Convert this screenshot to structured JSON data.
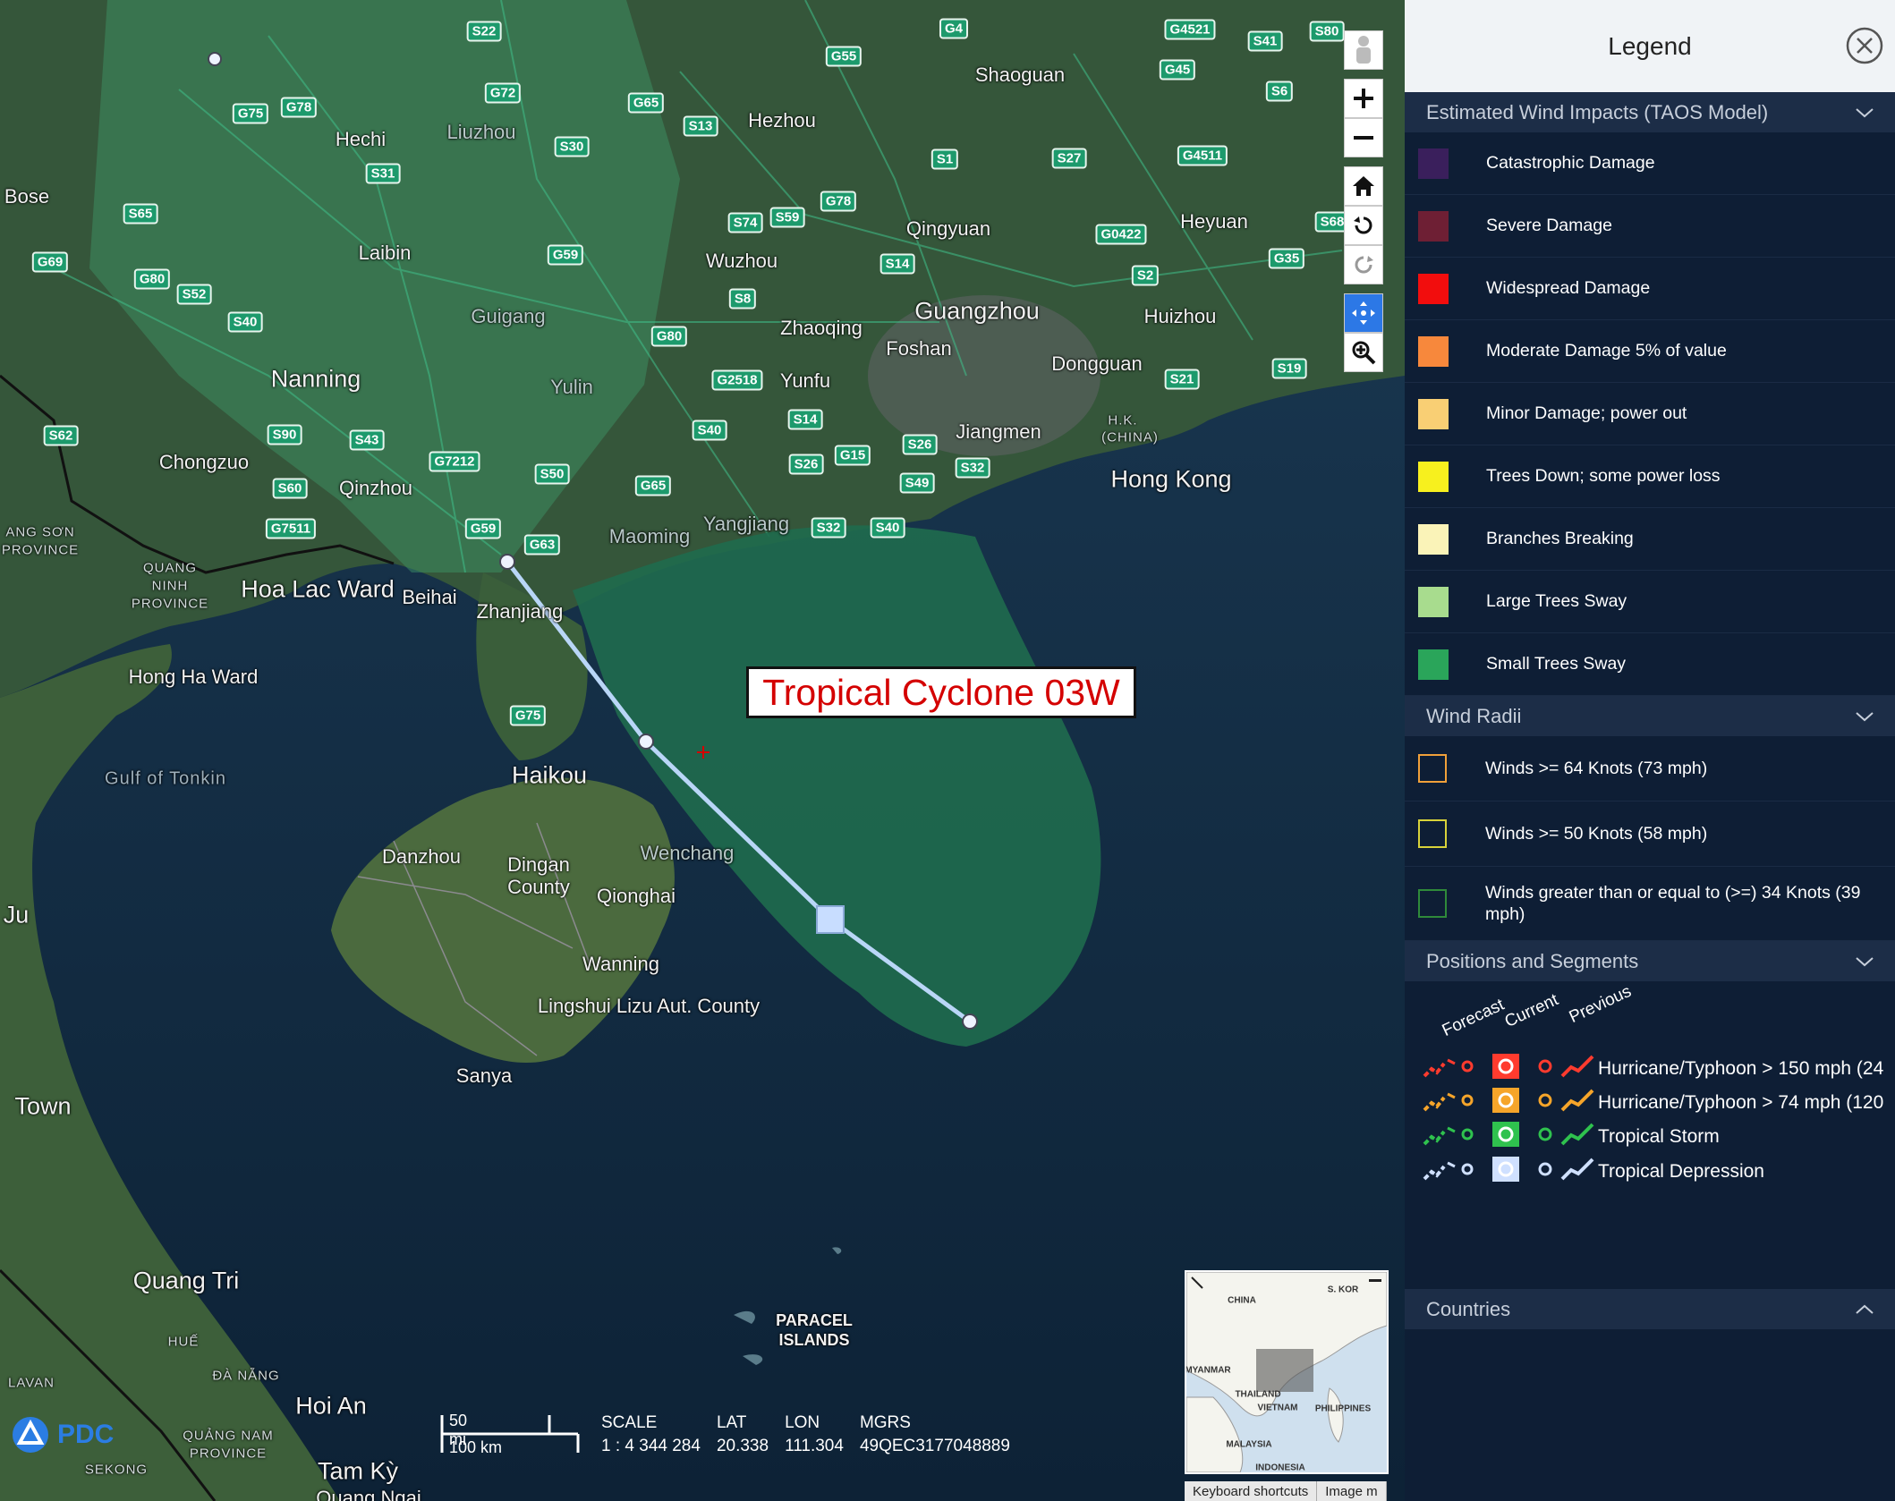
{
  "map": {
    "cyclone_label": "Tropical Cyclone 03W",
    "places": [
      {
        "name": "Shaoguan",
        "cls": "mid"
      },
      {
        "name": "Hezhou",
        "cls": "mid"
      },
      {
        "name": "Hechi",
        "cls": "mid"
      },
      {
        "name": "Liuzhou",
        "cls": "mid faint"
      },
      {
        "name": "Bose",
        "cls": "mid"
      },
      {
        "name": "Laibin",
        "cls": "mid"
      },
      {
        "name": "Qingyuan",
        "cls": "mid"
      },
      {
        "name": "Heyuan",
        "cls": "mid"
      },
      {
        "name": "Wuzhou",
        "cls": "mid"
      },
      {
        "name": "Guigang",
        "cls": "mid faint"
      },
      {
        "name": "Guangzhou",
        "cls": "major"
      },
      {
        "name": "Huizhou",
        "cls": "mid"
      },
      {
        "name": "Zhaoqing",
        "cls": "mid"
      },
      {
        "name": "Foshan",
        "cls": "mid"
      },
      {
        "name": "Nanning",
        "cls": "major"
      },
      {
        "name": "Yulin",
        "cls": "mid faint"
      },
      {
        "name": "Yunfu",
        "cls": "mid"
      },
      {
        "name": "Dongguan",
        "cls": "mid"
      },
      {
        "name": "Jiangmen",
        "cls": "mid"
      },
      {
        "name": "H.K.",
        "cls": "region"
      },
      {
        "name": "(CHINA)",
        "cls": "region"
      },
      {
        "name": "Hong Kong",
        "cls": "major"
      },
      {
        "name": "Chongzuo",
        "cls": "mid"
      },
      {
        "name": "Qinzhou",
        "cls": "mid"
      },
      {
        "name": "Maoming",
        "cls": "mid faint"
      },
      {
        "name": "Yangjiang",
        "cls": "mid faint"
      },
      {
        "name": "Hoa Lac Ward",
        "cls": "major"
      },
      {
        "name": "Beihai",
        "cls": "mid"
      },
      {
        "name": "Zhanjiang",
        "cls": "mid"
      },
      {
        "name": "Hong Ha Ward",
        "cls": "mid"
      },
      {
        "name": "Gulf of Tonkin",
        "cls": "sea"
      },
      {
        "name": "Haikou",
        "cls": "major"
      },
      {
        "name": "Danzhou",
        "cls": "mid"
      },
      {
        "name": "Dingan",
        "cls": "mid"
      },
      {
        "name": "County",
        "cls": "mid"
      },
      {
        "name": "Wenchang",
        "cls": "mid faint"
      },
      {
        "name": "Qionghai",
        "cls": "mid"
      },
      {
        "name": "Wanning",
        "cls": "mid"
      },
      {
        "name": "Lingshui Lizu Aut. County",
        "cls": "mid"
      },
      {
        "name": "Sanya",
        "cls": "mid"
      },
      {
        "name": "Town",
        "cls": "major"
      },
      {
        "name": "Quang Tri",
        "cls": "major"
      },
      {
        "name": "Hoi An",
        "cls": "major"
      },
      {
        "name": "Tam Kỳ",
        "cls": "major"
      },
      {
        "name": "HUẾ",
        "cls": "region"
      },
      {
        "name": "ĐÀ NẴNG",
        "cls": "region"
      },
      {
        "name": "QUẢNG NAM",
        "cls": "region"
      },
      {
        "name": "PROVINCE",
        "cls": "region"
      },
      {
        "name": "SEKONG",
        "cls": "region"
      },
      {
        "name": "LAVAN",
        "cls": "region"
      },
      {
        "name": "QUANG",
        "cls": "region"
      },
      {
        "name": "NINH",
        "cls": "region"
      },
      {
        "name": "PROVINCE",
        "cls": "region"
      },
      {
        "name": "ANG SƠN",
        "cls": "region"
      },
      {
        "name": "PROVINCE",
        "cls": "region"
      },
      {
        "name": "Ju",
        "cls": "major"
      },
      {
        "name": "Quang Ngai",
        "cls": "mid"
      }
    ],
    "islands_label": [
      "PARACEL",
      "ISLANDS"
    ],
    "shields": [
      "S22",
      "G72",
      "G75",
      "G78",
      "S31",
      "S30",
      "G65",
      "S13",
      "G55",
      "G4",
      "G4521",
      "S41",
      "S80",
      "G45",
      "S6",
      "S1",
      "S27",
      "G4511",
      "S65",
      "G69",
      "G80",
      "S52",
      "S40",
      "G59",
      "S74",
      "S59",
      "G78",
      "S14",
      "S8",
      "G0422",
      "S2",
      "G35",
      "S68",
      "G80",
      "G2518",
      "S14",
      "S40",
      "S26",
      "G15",
      "S26",
      "S32",
      "S49",
      "S62",
      "S90",
      "S43",
      "G7212",
      "S60",
      "G7511",
      "G59",
      "G63",
      "S50",
      "G65",
      "G75",
      "S19",
      "S21",
      "S32",
      "S40"
    ],
    "scale": {
      "bar_top": "50 mi",
      "bar_bottom": "100 km",
      "headers": [
        "SCALE",
        "LAT",
        "LON",
        "MGRS"
      ],
      "values": [
        "1 : 4 344 284",
        "20.338",
        "111.304",
        "49QEC3177048889"
      ]
    },
    "logo_text": "PDC",
    "minimap": {
      "labels": [
        "CHINA",
        "S. KOR",
        "MYANMAR",
        "THAILAND",
        "VIETNAM",
        "PHILIPPINES",
        "MALAYSIA",
        "INDONESIA"
      ]
    },
    "footer": [
      "Keyboard shortcuts",
      "Image m"
    ],
    "toolbar": [
      "street-view",
      "zoom-in",
      "zoom-out",
      "home",
      "rotate-left",
      "rotate-right",
      "pan",
      "zoom-area"
    ]
  },
  "legend": {
    "title": "Legend",
    "sections": {
      "wind_impacts": "Estimated Wind Impacts (TAOS Model)",
      "wind_radii": "Wind Radii",
      "positions": "Positions and Segments",
      "countries": "Countries"
    },
    "impacts": [
      {
        "label": "Catastrophic Damage",
        "color": "#3a1f5c"
      },
      {
        "label": "Severe Damage",
        "color": "#6e1f34"
      },
      {
        "label": "Widespread Damage",
        "color": "#f20d0d"
      },
      {
        "label": "Moderate Damage 5% of value",
        "color": "#f7883c"
      },
      {
        "label": "Minor Damage; power out",
        "color": "#f9cf74"
      },
      {
        "label": "Trees Down; some power loss",
        "color": "#f7f01e"
      },
      {
        "label": "Branches Breaking",
        "color": "#faf3b8"
      },
      {
        "label": "Large Trees Sway",
        "color": "#a8dc8e"
      },
      {
        "label": "Small Trees Sway",
        "color": "#2aa55a"
      }
    ],
    "radii": [
      {
        "label": "Winds >= 64 Knots (73 mph)",
        "color": "#f0a03a"
      },
      {
        "label": "Winds >= 50 Knots (58 mph)",
        "color": "#d8d23a"
      },
      {
        "label": "Winds greater than or equal to (>=) 34 Knots (39 mph)",
        "color": "#2f8a3a"
      }
    ],
    "positions_headers": [
      "Forecast",
      "Current",
      "Previous"
    ],
    "positions": [
      {
        "label": "Hurricane/Typhoon > 150 mph (24",
        "color": "#ff3b2e"
      },
      {
        "label": "Hurricane/Typhoon > 74 mph (120",
        "color": "#f6a52a"
      },
      {
        "label": "Tropical Storm",
        "color": "#2fc24e"
      },
      {
        "label": "Tropical Depression",
        "color": "#cfe0ff"
      }
    ]
  }
}
